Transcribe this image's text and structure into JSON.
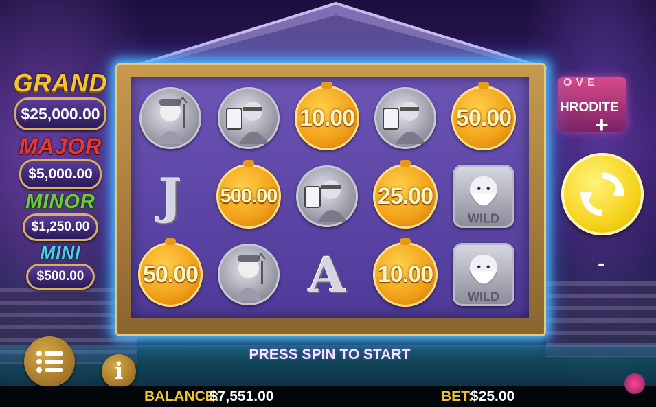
{
  "jackpots": [
    {
      "title": "GRAND",
      "amount": "$25,000.00",
      "color": "#f4c430"
    },
    {
      "title": "MAJOR",
      "amount": "$5,000.00",
      "color": "#e63a2e"
    },
    {
      "title": "MINOR",
      "amount": "$1,250.00",
      "color": "#6ccc3a"
    },
    {
      "title": "MINI",
      "amount": "$500.00",
      "color": "#4ad0e6"
    }
  ],
  "reels": {
    "rows": [
      [
        {
          "type": "character",
          "icon": "pirate-chef-icon"
        },
        {
          "type": "character",
          "icon": "card-dealer-icon"
        },
        {
          "type": "coin",
          "value": "10.00"
        },
        {
          "type": "character",
          "icon": "card-dealer-icon"
        },
        {
          "type": "coin",
          "value": "50.00"
        }
      ],
      [
        {
          "type": "letter",
          "value": "J"
        },
        {
          "type": "coin",
          "value": "500.00"
        },
        {
          "type": "character",
          "icon": "card-dealer-icon"
        },
        {
          "type": "coin",
          "value": "25.00"
        },
        {
          "type": "wild",
          "icon": "zeus-wild-icon",
          "label": "WILD"
        }
      ],
      [
        {
          "type": "coin",
          "value": "50.00"
        },
        {
          "type": "character",
          "icon": "pirate-chef-icon"
        },
        {
          "type": "letter",
          "value": "A"
        },
        {
          "type": "coin",
          "value": "10.00"
        },
        {
          "type": "wild",
          "icon": "zeus-wild-icon",
          "label": "WILD"
        }
      ]
    ]
  },
  "prompt": "PRESS SPIN TO START",
  "balance": {
    "label": "BALANCE:",
    "value": "$7,551.00"
  },
  "bet": {
    "label": "BET:",
    "value": "$25.00"
  },
  "controls": {
    "plus": "+",
    "minus": "-",
    "info": "i"
  },
  "sign": {
    "top": "OVE",
    "text": "HRODITE"
  }
}
